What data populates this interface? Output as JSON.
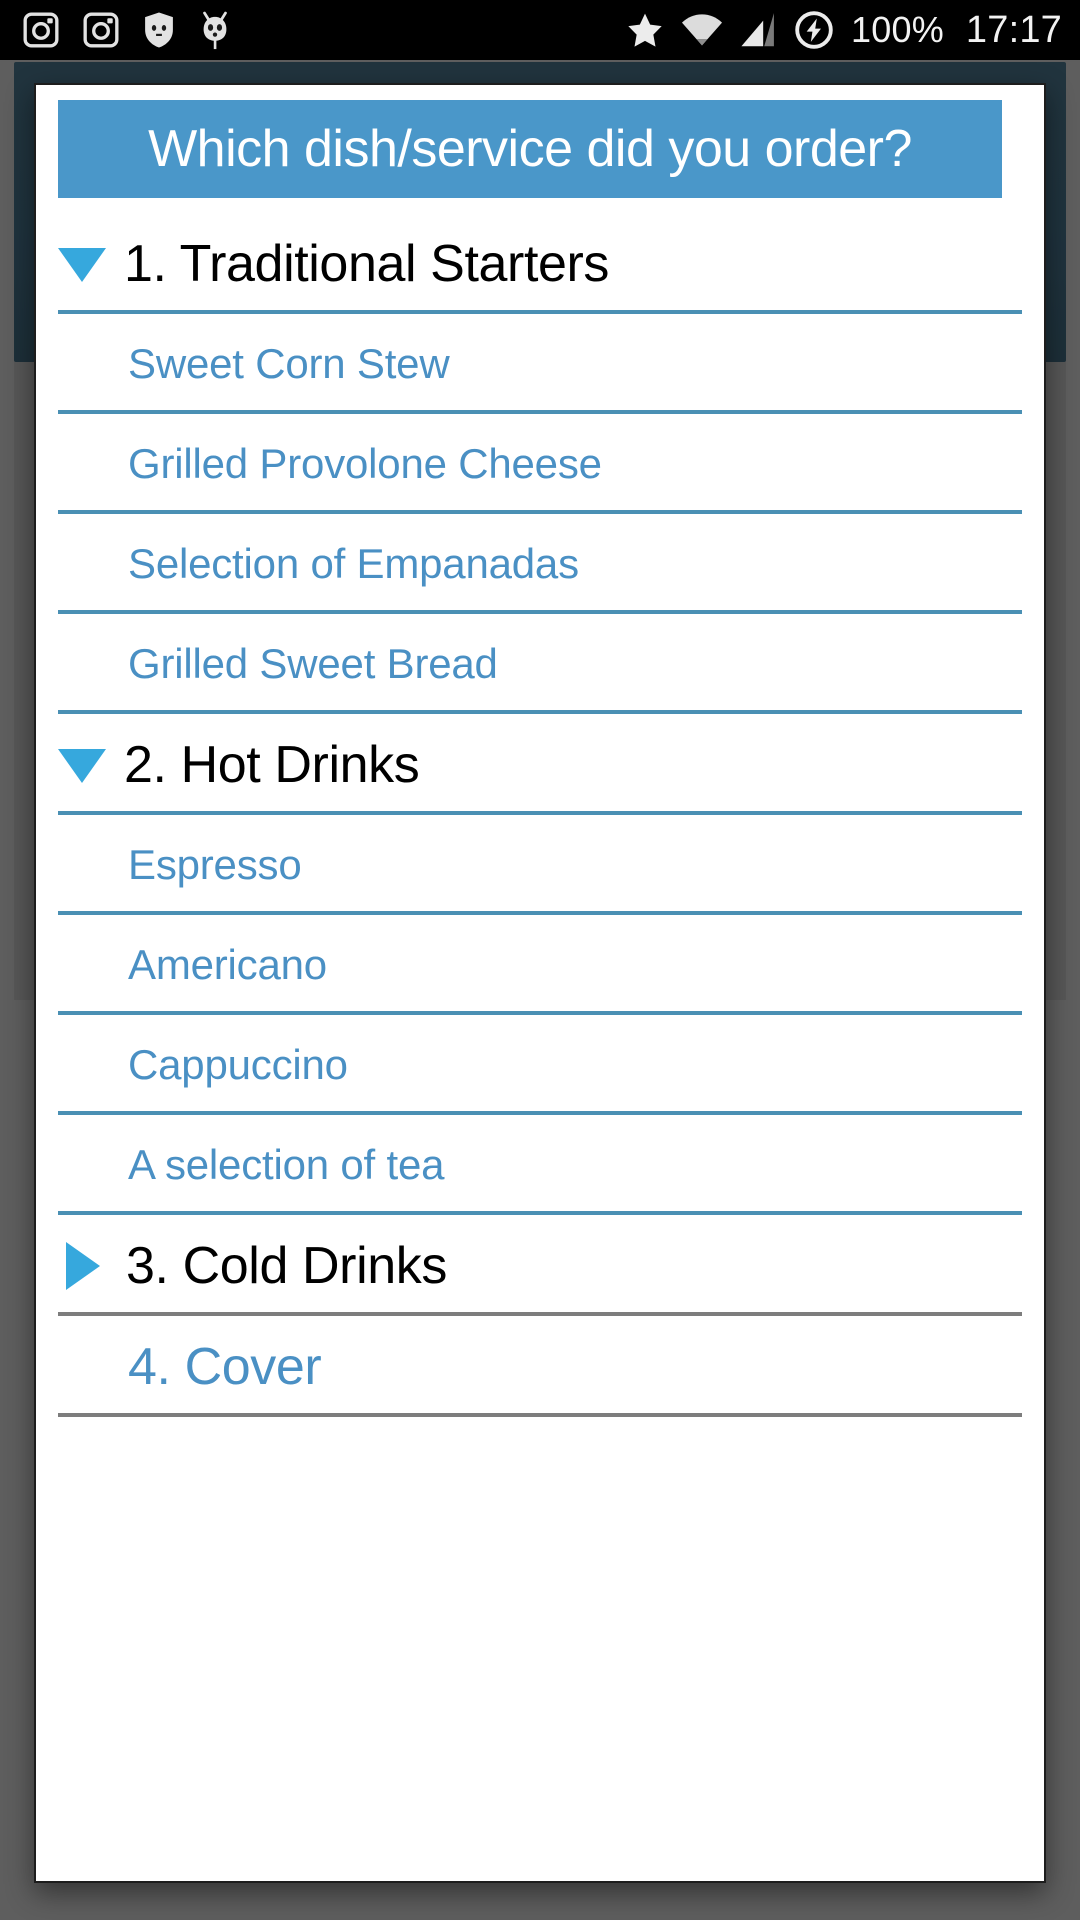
{
  "status_bar": {
    "left_icons": [
      {
        "name": "instagram-camera-icon",
        "glyph": "camera"
      },
      {
        "name": "instagram-camera-icon-2",
        "glyph": "camera"
      },
      {
        "name": "shield-cat-icon",
        "glyph": "shield"
      },
      {
        "name": "cyanogenmod-android-icon",
        "glyph": "android"
      }
    ],
    "right_icons": [
      {
        "name": "priority-star-icon",
        "glyph": "star"
      },
      {
        "name": "wifi-icon",
        "glyph": "wifi"
      },
      {
        "name": "cellular-signal-icon",
        "glyph": "signal"
      },
      {
        "name": "charging-bolt-icon",
        "glyph": "bolt"
      }
    ],
    "battery_percent": "100%",
    "clock": "17:17"
  },
  "dialog": {
    "title": "Which dish/service did you order?",
    "title_bg": "#4a97c9",
    "accent_blue": "#4a90c4",
    "triangle_blue": "#36a8dd",
    "divider_blue": "#4a90b4",
    "divider_gray": "#7d7d7d",
    "rows": [
      {
        "type": "group",
        "label": "1. Traditional Starters",
        "expanded": true,
        "indicator": "triangle-down-icon",
        "divider": "blue"
      },
      {
        "type": "child",
        "label": "Sweet Corn Stew",
        "divider": "blue"
      },
      {
        "type": "child",
        "label": "Grilled Provolone Cheese",
        "divider": "blue"
      },
      {
        "type": "child",
        "label": "Selection of Empanadas",
        "divider": "blue"
      },
      {
        "type": "child",
        "label": "Grilled Sweet Bread",
        "divider": "blue"
      },
      {
        "type": "group",
        "label": "2. Hot Drinks",
        "expanded": true,
        "indicator": "triangle-down-icon",
        "divider": "blue"
      },
      {
        "type": "child",
        "label": "Espresso",
        "divider": "blue"
      },
      {
        "type": "child",
        "label": "Americano",
        "divider": "blue"
      },
      {
        "type": "child",
        "label": "Cappuccino",
        "divider": "blue"
      },
      {
        "type": "child",
        "label": "A selection of tea",
        "divider": "blue"
      },
      {
        "type": "group",
        "label": "3. Cold Drinks",
        "expanded": false,
        "indicator": "triangle-right-icon",
        "divider": "gray"
      },
      {
        "type": "plain",
        "label": "4. Cover",
        "expanded": false,
        "indicator": "none",
        "divider": "gray"
      }
    ]
  }
}
